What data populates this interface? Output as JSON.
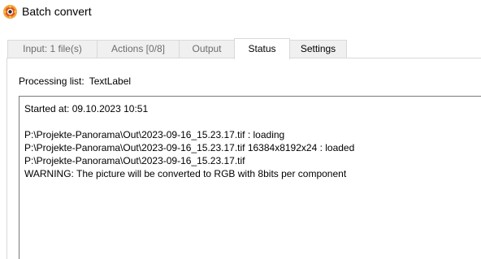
{
  "window": {
    "title": "Batch convert",
    "icon": "xnview-icon"
  },
  "tabs": [
    {
      "label": "Input: 1 file(s)",
      "active": false
    },
    {
      "label": "Actions [0/8]",
      "active": false
    },
    {
      "label": "Output",
      "active": false
    },
    {
      "label": "Status",
      "active": true
    },
    {
      "label": "Settings",
      "active": false
    }
  ],
  "status": {
    "processing_list_label": "Processing list:",
    "processing_list_value": "TextLabel",
    "log_lines": [
      "Started at: 09.10.2023 10:51",
      "",
      "P:\\Projekte-Panorama\\Out\\2023-09-16_15.23.17.tif : loading",
      "P:\\Projekte-Panorama\\Out\\2023-09-16_15.23.17.tif 16384x8192x24 : loaded",
      "P:\\Projekte-Panorama\\Out\\2023-09-16_15.23.17.tif",
      "WARNING: The picture will be converted to RGB with 8bits per component"
    ]
  },
  "colors": {
    "accent": "#e2501f",
    "tab_border": "#d9d9d9",
    "inactive_tab_bg": "#f0f0f0",
    "inactive_tab_text": "#6d6d6d"
  }
}
